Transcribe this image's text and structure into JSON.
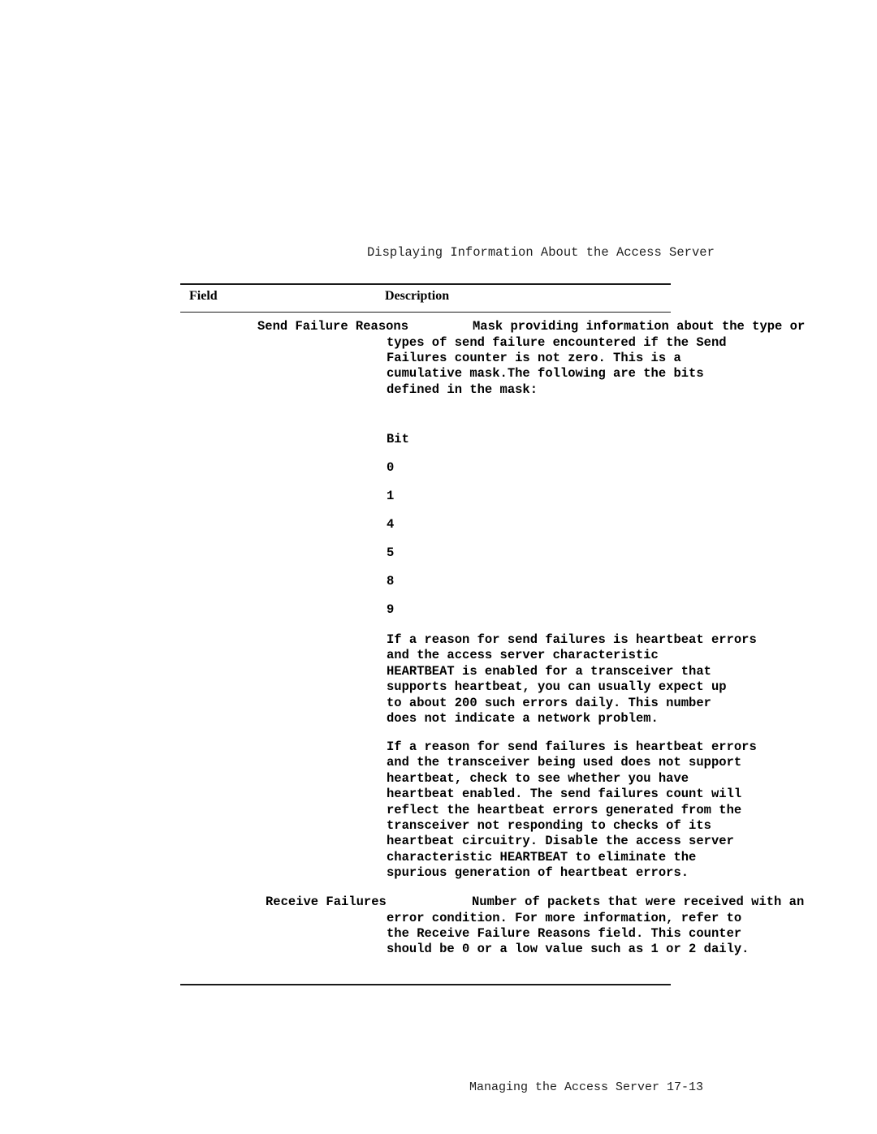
{
  "running_head": "Displaying Information About the Access Server",
  "table": {
    "headers": {
      "field": "Field",
      "description": "Description"
    },
    "rows": [
      {
        "field": "Send Failure Reasons",
        "first_line": "Mask providing information about the type or",
        "continuation": "types of send failure encountered if the Send\nFailures counter is not zero. This is a\ncumulative mask.The following are the bits\ndefined in the mask:",
        "bits_header": "Bit",
        "bits": [
          "0",
          "1",
          "4",
          "5",
          "8",
          "9"
        ],
        "notes": [
          "If a reason for send failures is heartbeat errors\nand the access server characteristic\nHEARTBEAT is enabled for a transceiver that\nsupports heartbeat, you can usually expect up\nto about 200 such errors daily. This number\ndoes not indicate a network problem.",
          "If a reason for send failures is heartbeat errors\nand the transceiver being used does not support\nheartbeat, check to see whether you have\nheartbeat enabled. The send failures count will\nreflect the heartbeat errors generated from the\ntransceiver not responding to checks of its\nheartbeat circuitry. Disable the access server\ncharacteristic HEARTBEAT to eliminate the\nspurious generation of heartbeat errors."
        ]
      },
      {
        "field": "Receive Failures",
        "first_line": "Number of packets that were received with an",
        "continuation": "error condition. For more information, refer to\nthe Receive Failure Reasons field. This counter\nshould be 0 or a low value such as 1 or 2 daily."
      }
    ]
  },
  "footer": "Managing the Access Server 17-13"
}
